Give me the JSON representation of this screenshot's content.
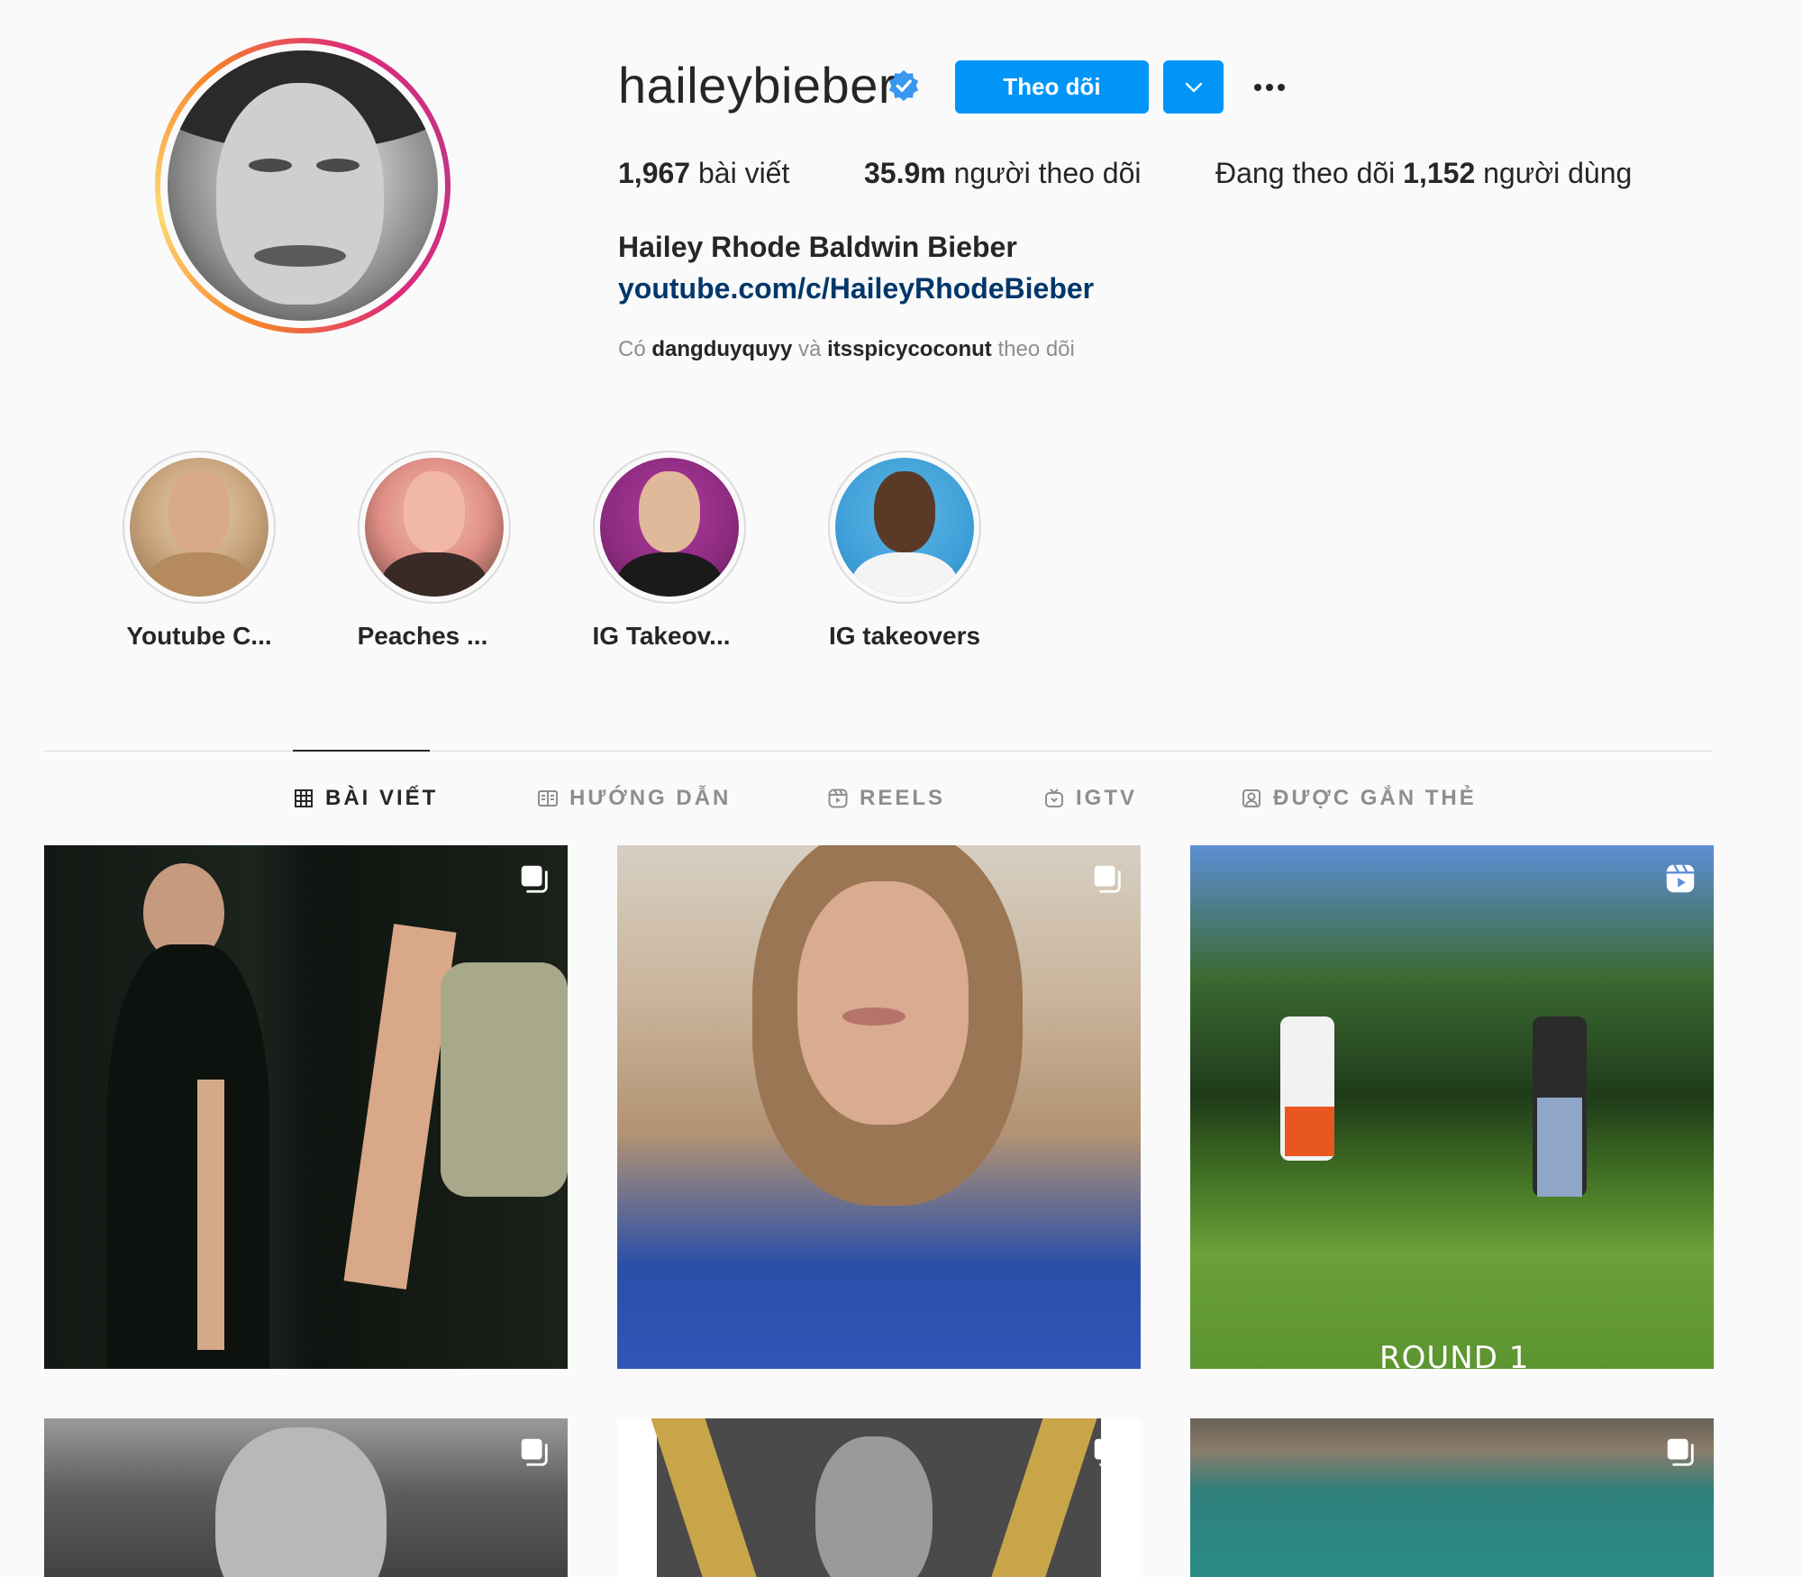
{
  "profile": {
    "username": "haileybieber",
    "follow_label": "Theo dõi",
    "full_name": "Hailey Rhode Baldwin Bieber",
    "link": "youtube.com/c/HaileyRhodeBieber",
    "stats": {
      "posts_count": "1,967",
      "posts_label": " bài viết",
      "followers_count": "35.9m",
      "followers_label": " người theo dõi",
      "following_prefix": "Đang theo dõi ",
      "following_count": "1,152",
      "following_suffix": " người dùng"
    },
    "followed_by": {
      "prefix": "Có ",
      "user1": "dangduyquyy",
      "conj": " và ",
      "user2": "itsspicycoconut",
      "suffix": " theo dõi"
    }
  },
  "highlights": [
    {
      "label": "Youtube C..."
    },
    {
      "label": "Peaches ..."
    },
    {
      "label": "IG Takeov..."
    },
    {
      "label": "IG takeovers"
    }
  ],
  "tabs": [
    {
      "label": "BÀI VIẾT",
      "icon": "grid-icon",
      "active": true
    },
    {
      "label": "HƯỚNG DẪN",
      "icon": "guide-icon",
      "active": false
    },
    {
      "label": "REELS",
      "icon": "reels-icon",
      "active": false
    },
    {
      "label": "IGTV",
      "icon": "igtv-icon",
      "active": false
    },
    {
      "label": "ĐƯỢC GẮN THẺ",
      "icon": "tagged-icon",
      "active": false
    }
  ],
  "posts": [
    {
      "badge": "carousel-icon"
    },
    {
      "badge": "carousel-icon"
    },
    {
      "badge": "reels-icon",
      "overlay_text": "ROUND 1"
    },
    {
      "badge": "carousel-icon"
    },
    {
      "badge": "carousel-icon"
    },
    {
      "badge": "carousel-icon"
    }
  ],
  "colors": {
    "accent": "#0095f6",
    "link": "#00376b",
    "verified": "#3897f0"
  }
}
